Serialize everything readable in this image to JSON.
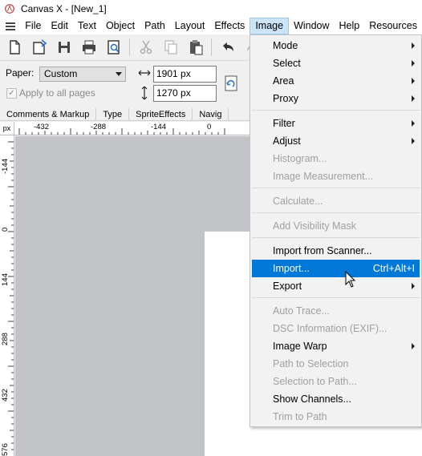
{
  "window": {
    "title": "Canvas X - [New_1]"
  },
  "menubar": {
    "items": [
      "File",
      "Edit",
      "Text",
      "Object",
      "Path",
      "Layout",
      "Effects",
      "Image",
      "Window",
      "Help",
      "Resources"
    ],
    "active": "Image"
  },
  "toolbar": {
    "buttons": [
      "new-document-icon",
      "open-icon",
      "save-icon",
      "print-icon",
      "print-preview-icon",
      "cut-icon",
      "copy-icon",
      "paste-icon",
      "undo-icon",
      "redo-icon"
    ]
  },
  "propbar": {
    "paper_label": "Paper:",
    "paper_value": "Custom",
    "apply_label": "Apply to all pages",
    "width_value": "1901 px",
    "height_value": "1270 px"
  },
  "tabs": [
    "Comments & Markup",
    "Type",
    "SpriteEffects",
    "Navig"
  ],
  "ruler": {
    "unit": "px",
    "h_labels": [
      "-432",
      "-288",
      "-144",
      "0"
    ],
    "v_labels": [
      "-144",
      "0",
      "144",
      "288",
      "432",
      "576"
    ]
  },
  "image_menu": {
    "items": [
      {
        "label": "Mode",
        "submenu": true,
        "enabled": true
      },
      {
        "label": "Select",
        "submenu": true,
        "enabled": true
      },
      {
        "label": "Area",
        "submenu": true,
        "enabled": true
      },
      {
        "label": "Proxy",
        "submenu": true,
        "enabled": true
      },
      {
        "label": "Filter",
        "submenu": true,
        "enabled": true
      },
      {
        "label": "Adjust",
        "submenu": true,
        "enabled": true
      },
      {
        "label": "Histogram...",
        "submenu": false,
        "enabled": false
      },
      {
        "label": "Image Measurement...",
        "submenu": false,
        "enabled": false
      },
      {
        "label": "Calculate...",
        "submenu": false,
        "enabled": false
      },
      {
        "label": "Add Visibility Mask",
        "submenu": false,
        "enabled": false
      },
      {
        "label": "Import from Scanner...",
        "submenu": false,
        "enabled": true
      },
      {
        "label": "Import...",
        "submenu": false,
        "enabled": true,
        "shortcut": "Ctrl+Alt+I",
        "highlighted": true
      },
      {
        "label": "Export",
        "submenu": true,
        "enabled": true
      },
      {
        "label": "Auto Trace...",
        "submenu": false,
        "enabled": false
      },
      {
        "label": "DSC Information (EXIF)...",
        "submenu": false,
        "enabled": false
      },
      {
        "label": "Image Warp",
        "submenu": true,
        "enabled": true
      },
      {
        "label": "Path to Selection",
        "submenu": false,
        "enabled": false
      },
      {
        "label": "Selection to Path...",
        "submenu": false,
        "enabled": false
      },
      {
        "label": "Show Channels...",
        "submenu": false,
        "enabled": true
      },
      {
        "label": "Trim to Path",
        "submenu": false,
        "enabled": false
      }
    ]
  },
  "colors": {
    "canvas_bg": "#c2c4c7",
    "menu_highlight": "#0078d7",
    "active_menu_bg": "#cce4f7",
    "disabled_text": "#a0a0a0"
  }
}
